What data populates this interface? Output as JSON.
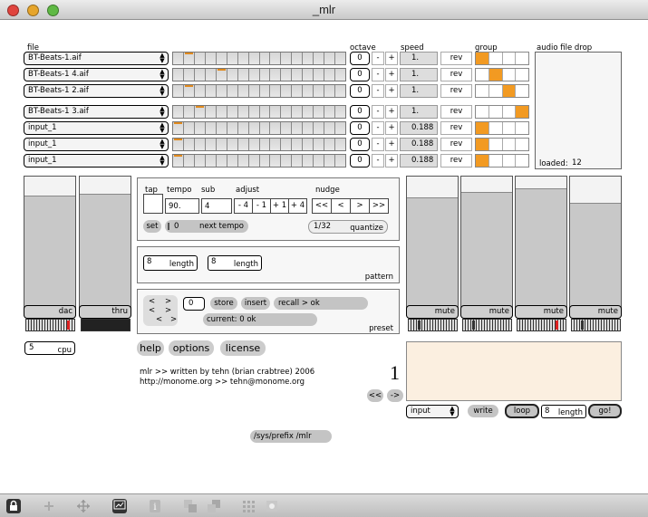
{
  "window": {
    "title": "_mlr"
  },
  "headers": {
    "file": "file",
    "octave": "octave",
    "speed": "speed",
    "group": "group",
    "drop": "audio file drop"
  },
  "tracks": [
    {
      "file": "BT-Beats-1.aif",
      "octave": "0",
      "speed": "1.",
      "mark": 1,
      "group": 0
    },
    {
      "file": "BT-Beats-1 4.aif",
      "octave": "0",
      "speed": "1.",
      "mark": 4,
      "group": 1
    },
    {
      "file": "BT-Beats-1 2.aif",
      "octave": "0",
      "speed": "1.",
      "mark": 1,
      "group": 2
    },
    {
      "file": "BT-Beats-1 3.aif",
      "octave": "0",
      "speed": "1.",
      "mark": 2,
      "group": 3
    },
    {
      "file": "input_1",
      "octave": "0",
      "speed": "0.188",
      "mark": 0,
      "group": 0
    },
    {
      "file": "input_1",
      "octave": "0",
      "speed": "0.188",
      "mark": 0,
      "group": 0
    },
    {
      "file": "input_1",
      "octave": "0",
      "speed": "0.188",
      "mark": 0,
      "group": 0
    }
  ],
  "row_buttons": {
    "minus": "-",
    "plus": "+",
    "rev": "rev"
  },
  "loaded": {
    "label": "loaded:",
    "value": "12"
  },
  "faders": {
    "dac": "dac",
    "thru": "thru",
    "mute": "mute"
  },
  "cpu": {
    "value": "5",
    "label": "cpu"
  },
  "tempo": {
    "tap": "tap",
    "tempo_label": "tempo",
    "tempo_value": "90.",
    "sub_label": "sub",
    "sub_value": "4",
    "adjust_label": "adjust",
    "adjust": [
      "- 4",
      "- 1",
      "+ 1",
      "+ 4"
    ],
    "nudge_label": "nudge",
    "nudge": [
      "<<",
      "<",
      ">",
      ">>"
    ],
    "set": "set",
    "next_value": "0",
    "next_label": "next tempo",
    "quantize_value": "1/32",
    "quantize_label": "quantize"
  },
  "pattern": {
    "len1": "8",
    "len2": "8",
    "length_label": "length",
    "label": "pattern"
  },
  "preset": {
    "arrows": [
      "<",
      ">",
      "<",
      ">",
      "<",
      ">"
    ],
    "number": "0",
    "store": "store",
    "insert": "insert",
    "recall": "recall > ok",
    "current": "current: 0 ok",
    "label": "preset"
  },
  "buttons": {
    "help": "help",
    "options": "options",
    "license": "license"
  },
  "credits": {
    "line1": "mlr >> written by tehn (brian crabtree) 2006",
    "line2": "http://monome.org >> tehn@monome.org"
  },
  "recorder": {
    "number": "1",
    "prev": "<<",
    "next": "->",
    "input": "input",
    "write": "write",
    "loop": "loop",
    "length_value": "8",
    "length_label": "length",
    "go": "go!"
  },
  "prefix": "/sys/prefix /mlr",
  "colors": {
    "accent": "#f29a22",
    "recorder_bg": "#fbefe0"
  }
}
